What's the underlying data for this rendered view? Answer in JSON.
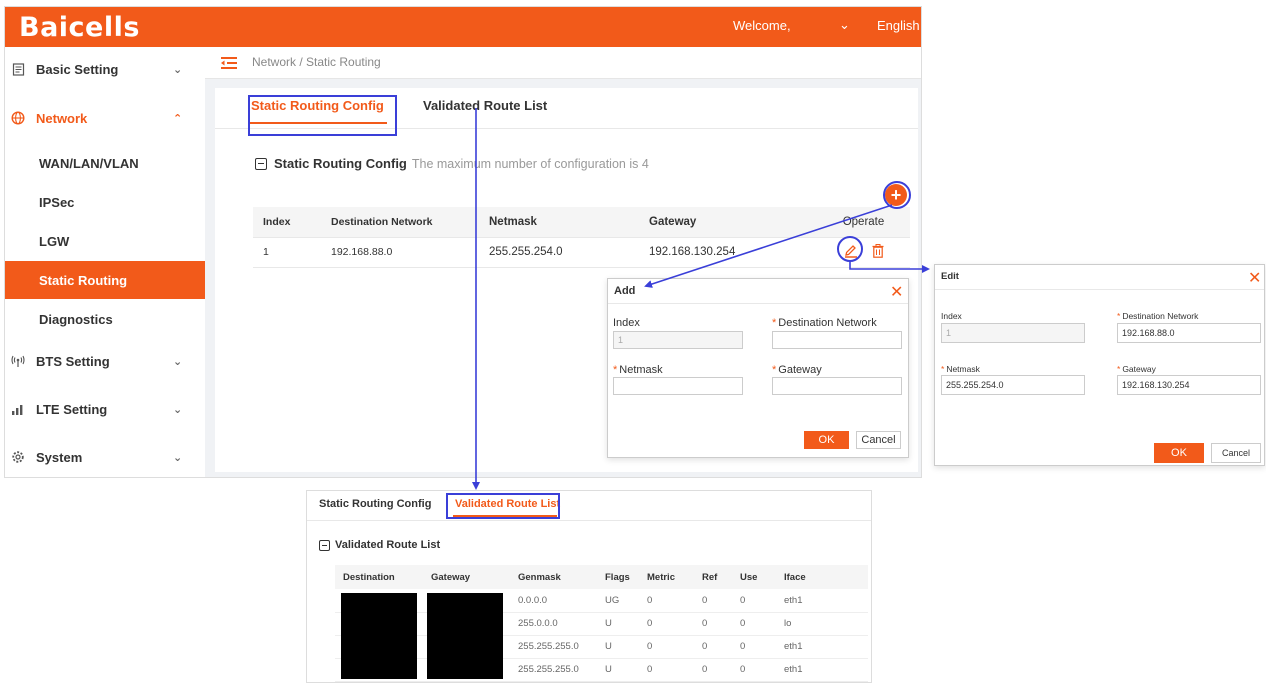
{
  "topbar": {
    "logo": "Baicells",
    "welcome": "Welcome,",
    "language": "English"
  },
  "sidebar": {
    "items": [
      {
        "label": "Basic Setting",
        "icon": "document-icon"
      },
      {
        "label": "Network",
        "icon": "network-icon"
      },
      {
        "label": "BTS Setting",
        "icon": "antenna-icon"
      },
      {
        "label": "LTE Setting",
        "icon": "signal-icon"
      },
      {
        "label": "System",
        "icon": "gear-icon"
      }
    ],
    "network_children": [
      "WAN/LAN/VLAN",
      "IPSec",
      "LGW",
      "Static Routing",
      "Diagnostics"
    ],
    "active": "Static Routing"
  },
  "breadcrumb": "Network / Static Routing",
  "tabs": [
    "Static Routing Config",
    "Validated Route List"
  ],
  "section": {
    "title": "Static Routing Config",
    "hint": "The maximum number of configuration is 4"
  },
  "routes_table": {
    "columns": [
      "Index",
      "Destination Network",
      "Netmask",
      "Gateway",
      "Operate"
    ],
    "rows": [
      [
        "1",
        "192.168.88.0",
        "255.255.254.0",
        "192.168.130.254"
      ]
    ]
  },
  "add_dialog": {
    "title": "Add",
    "fields": {
      "index_label": "Index",
      "index_value": "1",
      "dest_label": "Destination Network",
      "netmask_label": "Netmask",
      "gateway_label": "Gateway"
    },
    "ok": "OK",
    "cancel": "Cancel"
  },
  "edit_dialog": {
    "title": "Edit",
    "fields": {
      "index_label": "Index",
      "index_value": "1",
      "dest_label": "Destination Network",
      "dest_value": "192.168.88.0",
      "netmask_label": "Netmask",
      "netmask_value": "255.255.254.0",
      "gateway_label": "Gateway",
      "gateway_value": "192.168.130.254"
    },
    "ok": "OK",
    "cancel": "Cancel"
  },
  "validated_panel": {
    "tabs": [
      "Static Routing Config",
      "Validated Route List"
    ],
    "title": "Validated Route List",
    "columns": [
      "Destination",
      "Gateway",
      "Genmask",
      "Flags",
      "Metric",
      "Ref",
      "Use",
      "Iface"
    ],
    "rows": [
      [
        "",
        "",
        "0.0.0.0",
        "UG",
        "0",
        "0",
        "0",
        "eth1"
      ],
      [
        "",
        "",
        "255.0.0.0",
        "U",
        "0",
        "0",
        "0",
        "lo"
      ],
      [
        "",
        "",
        "255.255.255.0",
        "U",
        "0",
        "0",
        "0",
        "eth1"
      ],
      [
        "",
        "",
        "255.255.255.0",
        "U",
        "0",
        "0",
        "0",
        "eth1"
      ]
    ]
  },
  "colors": {
    "brand": "#f25a1a",
    "highlight": "#3a3fd8"
  }
}
